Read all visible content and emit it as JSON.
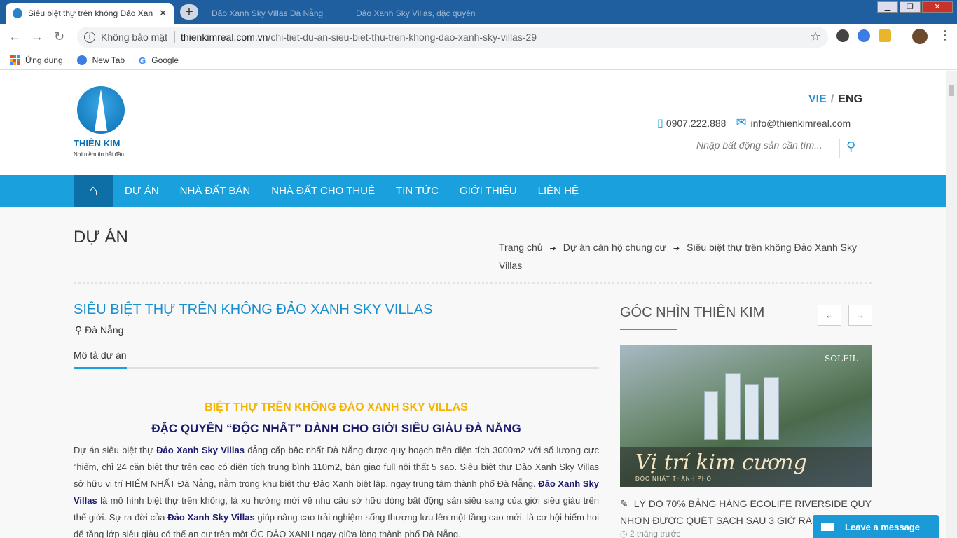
{
  "browser": {
    "active_tab": "Siêu biệt thự trên không Đảo Xan",
    "inactive_tabs": [
      "Đảo Xanh Sky Villas Đà Nẵng",
      "Đảo Xanh Sky Villas, đặc quyền"
    ],
    "security_label": "Không bảo mật",
    "url_domain": "thienkimreal.com.vn",
    "url_path": "/chi-tiet-du-an-sieu-biet-thu-tren-khong-dao-xanh-sky-villas-29",
    "bookmarks": [
      "Ứng dụng",
      "New Tab",
      "Google"
    ]
  },
  "header": {
    "logo_name": "THIÊN KIM",
    "logo_slogan": "Nơi niềm tin bắt đầu",
    "lang_vie": "VIE",
    "lang_sep": "/",
    "lang_eng": "ENG",
    "phone": "0907.222.888",
    "email": "info@thienkimreal.com",
    "search_placeholder": "Nhập bất động sản cần tìm..."
  },
  "nav": {
    "items": [
      "DỰ ÁN",
      "NHÀ ĐẤT BÁN",
      "NHÀ ĐẤT CHO THUÊ",
      "TIN TỨC",
      "GIỚI THIỆU",
      "LIÊN HỆ"
    ]
  },
  "main": {
    "page_title": "DỰ ÁN",
    "breadcrumb": [
      "Trang chủ",
      "Dự án căn hộ chung cư",
      "Siêu biệt thự trên không Đảo Xanh Sky Villas"
    ],
    "project_title": "SIÊU BIỆT THỰ TRÊN KHÔNG ĐẢO XANH SKY VILLAS",
    "location": "Đà Nẵng",
    "tab_label": "Mô tả dự án",
    "headline1": "BIỆT THỰ TRÊN KHÔNG ĐẢO XANH SKY VILLAS",
    "headline2": "ĐẶC QUYỀN “ĐỘC NHẤT” DÀNH CHO GIỚI SIÊU GIÀU ĐÀ NẴNG",
    "para_1": "Dự án siêu biệt thự ",
    "para_2": "Đảo Xanh Sky Villas",
    "para_3": " đẳng cấp bậc nhất Đà Nẵng được quy hoạch trên diện tích 3000m2 với số lượng cực “hiếm, chỉ 24 căn biệt thự trên cao có diện tích trung bình 110m2, bàn giao full nội thất 5 sao. Siêu biệt thự Đảo Xanh Sky Villas sở hữu vị trí HIẾM NHẤT Đà Nẵng, nằm trong khu biệt thự Đảo Xanh biệt lập, ngay trung tâm thành phố Đà Nẵng. ",
    "para_4": "Đảo Xanh Sky Villas",
    "para_5": " là mô hình biệt thự trên không, là xu hướng mới về nhu cầu sở hữu dòng bất động sản siêu sang của giới siêu giàu trên thế giới. Sự ra đời của ",
    "para_6": "Đảo Xanh Sky Villas",
    "para_7": " giúp nâng cao trải nghiệm sống thượng lưu lên một tầng cao mới, là cơ hội hiếm hoi để tầng lớp siêu giàu có thể an cư trên một ỐC ĐẢO XANH ngay giữa lòng thành phố Đà Nẵng."
  },
  "sidebar": {
    "heading": "GÓC NHÌN THIÊN KIM",
    "prev": "←",
    "next": "→",
    "image_text_1": "Vị trí kim cương",
    "image_text_2": "ĐỘC NHẤT THÀNH PHỐ",
    "image_brand": "SOLEIL",
    "news_title": "LÝ DO 70% BẢNG HÀNG ECOLIFE RIVERSIDE QUY NHƠN ĐƯỢC QUÉT SẠCH SAU 3 GIỜ RA MẮ",
    "news_time": "2 tháng trước"
  },
  "chat": {
    "label": "Leave a message"
  },
  "colors": {
    "accent": "#19a0dd",
    "nav_home": "#0e6ea6",
    "headline_gold": "#f5b400",
    "headline_navy": "#1a1a6e"
  }
}
